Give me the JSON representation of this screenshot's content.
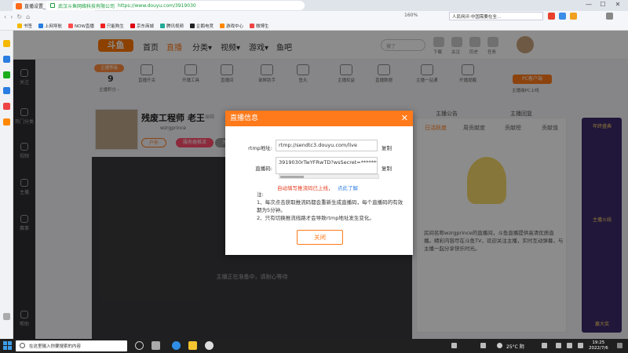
{
  "browser": {
    "tab_title": "直播设置_斗鱼 - 每个人的直播平台",
    "new_tab": "+",
    "address_company": "武汉斗鱼网络科技有限公司",
    "address_url": "https://www.douyu.com/3919030",
    "zoom": "160%",
    "search_hint": "人民网评:中国需要在全…",
    "win_min": "—",
    "win_max": "☐",
    "win_close": "✕",
    "bookmarks": [
      "书签",
      "上网导航",
      "NOW直播",
      "只能购生",
      "京东商城",
      "腾讯视频",
      "企鹅电竞",
      "游戏中心",
      "微博生"
    ]
  },
  "douyu": {
    "logo": "斗鱼",
    "nav": [
      "首页",
      "直播",
      "分类▾",
      "视频▾",
      "游戏▾",
      "鱼吧"
    ],
    "search_placeholder": "搜了",
    "header_icons": [
      "下载",
      "关注",
      "历史",
      "任务",
      "客户端"
    ],
    "level_badge": "主播等级",
    "level_num": "9",
    "level_label": "主播积分 ›",
    "stats": [
      "直播开关",
      "开播工具",
      "直播间",
      "录屏助手",
      "鱼丸",
      "主播权益",
      "直播数据",
      "主播一站通",
      "开播提醒",
      "粉丝"
    ],
    "pc_button": "PC客户端",
    "pc_label": "主播端PC上线",
    "room_name": "残废工程师 老王",
    "room_tag": "编辑",
    "room_user": "wzrgprince",
    "room_cat": "户外",
    "room_cat2": "服务器推流",
    "room_cat3": "关",
    "announce": "主播公告",
    "announce2": "主播回复",
    "right_tabs": [
      "日活跃度",
      "周贡献度",
      "贡献榜",
      "贡献值"
    ],
    "stream_text": "房间名称wzrgprince的直播间，斗鱼直播提供高清优质直播。精彩内容尽在斗鱼TV，欢迎关注主播，实时互动弹幕，与主播一起分享快乐时光。",
    "video_text": "主播正在准备中，请耐心等待",
    "left_nav": [
      "关注",
      "热门分类",
      "视频",
      "主播",
      "赛事",
      "帮助"
    ],
    "promo": [
      "年终盛典",
      "主播火线",
      "赢大奖"
    ]
  },
  "dialog": {
    "title": "直播信息",
    "close": "✕",
    "rtmp_label": "rtmp地址:",
    "rtmp_value": "rtmp://sendtc3.douyu.com/live",
    "code_label": "直播码:",
    "code_value": "3919030rTwYFRwTD?wsSecret=**********",
    "copy": "复制",
    "warn": "自动填写推流码已上线，",
    "warn_link": "点此了解",
    "note_title": "注:",
    "note1": "1、每次点击获取推流码都会重新生成直播码，每个直播码的有效期为5分钟。",
    "note2": "2、只有切换推流线路才会导致rtmp地址发生变化。",
    "close_button": "关闭"
  },
  "taskbar": {
    "search": "在这里输入你要搜索的内容",
    "weather": "25°C 阴",
    "time": "19:25",
    "date": "2022/7/6"
  }
}
